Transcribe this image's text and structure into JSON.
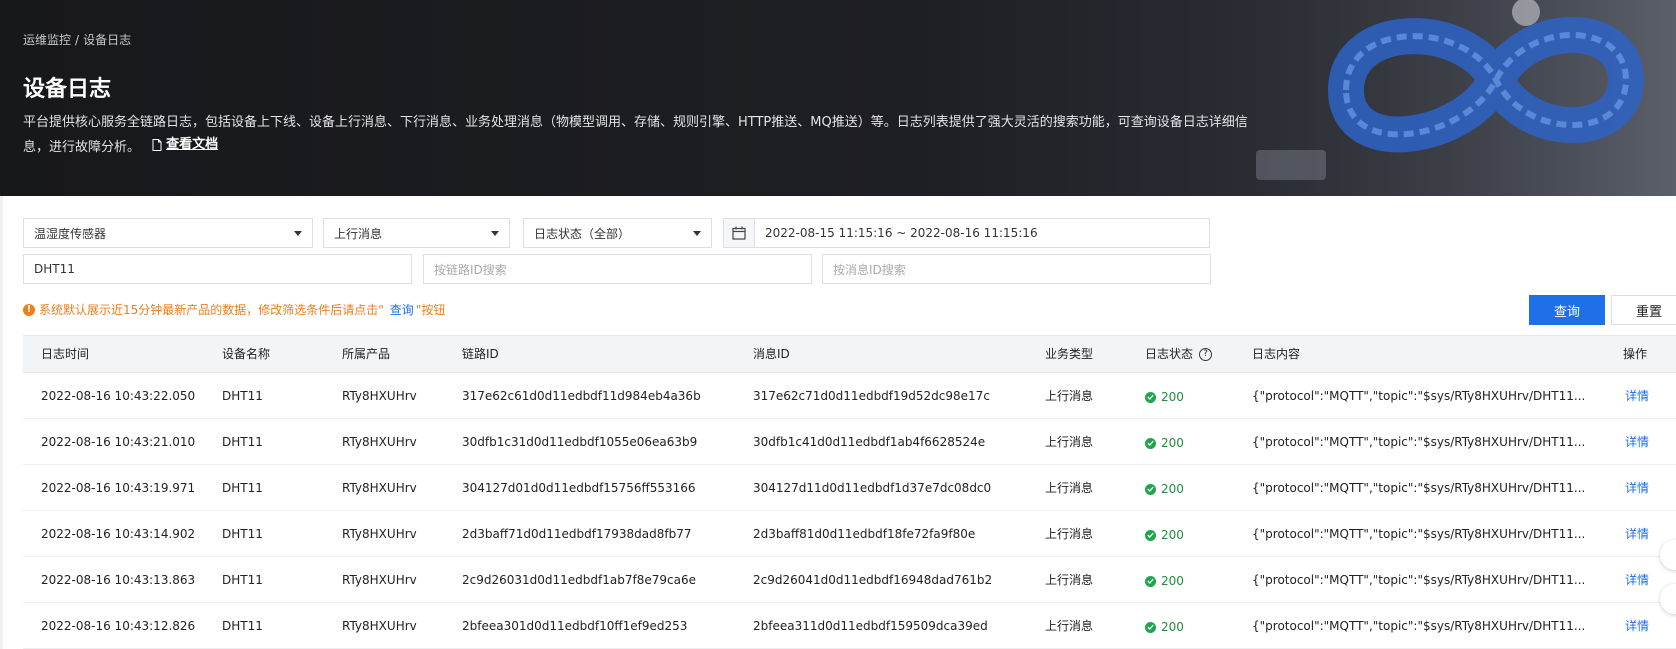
{
  "breadcrumb": [
    "运维监控",
    "/",
    "设备日志"
  ],
  "page": {
    "title": "设备日志",
    "description": "平台提供核心服务全链路日志，包括设备上下线、设备上行消息、下行消息、业务处理消息（物模型调用、存储、规则引擎、HTTP推送、MQ推送）等。日志列表提供了强大灵活的搜索功能，可查询设备日志详细信息，进行故障分析。",
    "doc_link": "查看文档"
  },
  "filters": {
    "product": "温湿度传感器",
    "message_type": "上行消息",
    "log_status": "日志状态（全部）",
    "date_range": "2022-08-15 11:15:16 ~ 2022-08-16 11:15:16",
    "device_name": "DHT11",
    "trace_id_placeholder": "按链路ID搜索",
    "message_id_placeholder": "按消息ID搜索"
  },
  "notice": {
    "text": "系统默认展示近15分钟最新产品的数据，修改筛选条件后请点击\"",
    "link": "查询",
    "suffix": "\"按钮"
  },
  "buttons": {
    "query": "查询",
    "reset": "重置"
  },
  "table": {
    "columns": [
      "日志时间",
      "设备名称",
      "所属产品",
      "链路ID",
      "消息ID",
      "业务类型",
      "日志状态",
      "日志内容",
      "操作"
    ],
    "rows": [
      {
        "time": "2022-08-16 10:43:22.050",
        "device": "DHT11",
        "product": "RTy8HXUHrv",
        "trace_id": "317e62c61d0d11edbdf11d984eb4a36b",
        "msg_id": "317e62c71d0d11edbdf19d52dc98e17c",
        "biz_type": "上行消息",
        "status": "200",
        "content": "{\"protocol\":\"MQTT\",\"topic\":\"$sys/RTy8HXUHrv/DHT11...",
        "action": "详情"
      },
      {
        "time": "2022-08-16 10:43:21.010",
        "device": "DHT11",
        "product": "RTy8HXUHrv",
        "trace_id": "30dfb1c31d0d11edbdf1055e06ea63b9",
        "msg_id": "30dfb1c41d0d11edbdf1ab4f6628524e",
        "biz_type": "上行消息",
        "status": "200",
        "content": "{\"protocol\":\"MQTT\",\"topic\":\"$sys/RTy8HXUHrv/DHT11...",
        "action": "详情"
      },
      {
        "time": "2022-08-16 10:43:19.971",
        "device": "DHT11",
        "product": "RTy8HXUHrv",
        "trace_id": "304127d01d0d11edbdf15756ff553166",
        "msg_id": "304127d11d0d11edbdf1d37e7dc08dc0",
        "biz_type": "上行消息",
        "status": "200",
        "content": "{\"protocol\":\"MQTT\",\"topic\":\"$sys/RTy8HXUHrv/DHT11...",
        "action": "详情"
      },
      {
        "time": "2022-08-16 10:43:14.902",
        "device": "DHT11",
        "product": "RTy8HXUHrv",
        "trace_id": "2d3baff71d0d11edbdf17938dad8fb77",
        "msg_id": "2d3baff81d0d11edbdf18fe72fa9f80e",
        "biz_type": "上行消息",
        "status": "200",
        "content": "{\"protocol\":\"MQTT\",\"topic\":\"$sys/RTy8HXUHrv/DHT11...",
        "action": "详情"
      },
      {
        "time": "2022-08-16 10:43:13.863",
        "device": "DHT11",
        "product": "RTy8HXUHrv",
        "trace_id": "2c9d26031d0d11edbdf1ab7f8e79ca6e",
        "msg_id": "2c9d26041d0d11edbdf16948dad761b2",
        "biz_type": "上行消息",
        "status": "200",
        "content": "{\"protocol\":\"MQTT\",\"topic\":\"$sys/RTy8HXUHrv/DHT11...",
        "action": "详情"
      },
      {
        "time": "2022-08-16 10:43:12.826",
        "device": "DHT11",
        "product": "RTy8HXUHrv",
        "trace_id": "2bfeea301d0d11edbdf10ff1ef9ed253",
        "msg_id": "2bfeea311d0d11edbdf159509dca39ed",
        "biz_type": "上行消息",
        "status": "200",
        "content": "{\"protocol\":\"MQTT\",\"topic\":\"$sys/RTy8HXUHrv/DHT11...",
        "action": "详情"
      }
    ]
  },
  "colors": {
    "primary": "#1f6fe8",
    "success": "#1ea54e",
    "warning": "#ee7d1a",
    "banner": "#1e1f24"
  },
  "icons": [
    "document-icon",
    "calendar-icon",
    "info-icon",
    "help-icon",
    "check-circle-icon",
    "caret-down-icon"
  ]
}
